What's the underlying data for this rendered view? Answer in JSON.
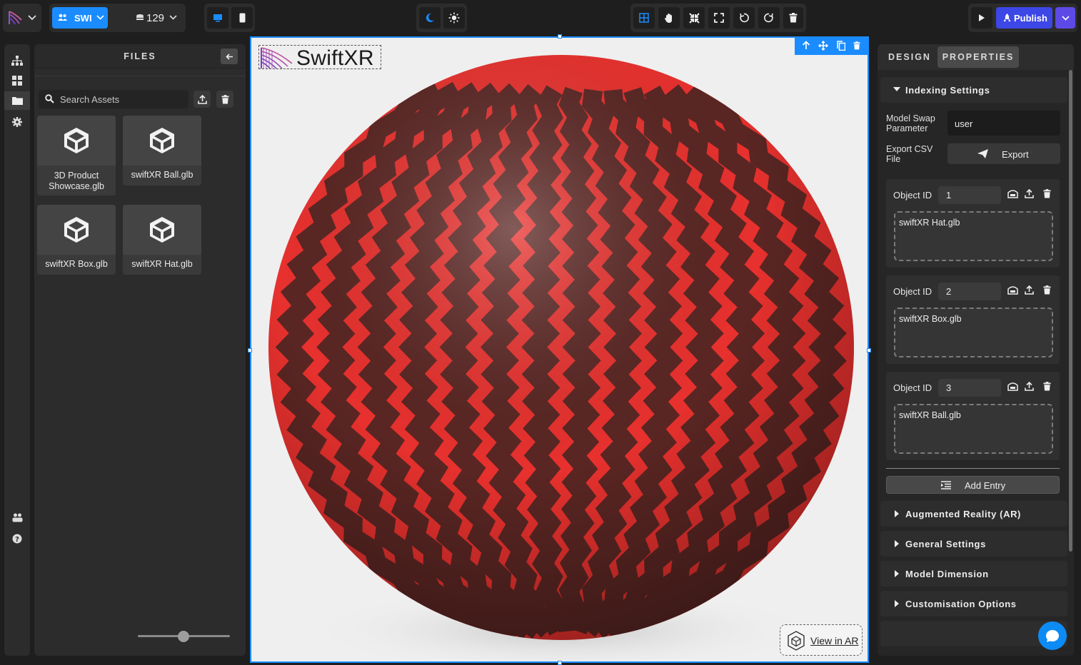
{
  "topbar": {
    "workspace_label": "SWI",
    "credits": "129",
    "publish_label": "Publish"
  },
  "files": {
    "title": "FILES",
    "search_placeholder": "Search Assets",
    "assets": [
      {
        "name": "3D Product Showcase.glb"
      },
      {
        "name": "swiftXR Ball.glb"
      },
      {
        "name": "swiftXR Box.glb"
      },
      {
        "name": "swiftXR Hat.glb"
      }
    ],
    "zoom_level": 0.5
  },
  "canvas": {
    "logo_text": "SwiftXR",
    "view_ar_label": "View in AR",
    "model_colors": {
      "primary": "#e8312e",
      "dark": "#5a2623"
    }
  },
  "right": {
    "tabs": [
      "DESIGN",
      "PROPERTIES"
    ],
    "active_tab": "PROPERTIES",
    "indexing": {
      "title": "Indexing Settings",
      "model_swap_label": "Model Swap Parameter",
      "model_swap_value": "user",
      "export_label": "Export CSV File",
      "export_button": "Export",
      "object_id_label": "Object ID",
      "entries": [
        {
          "id": "1",
          "model": "swiftXR Hat.glb"
        },
        {
          "id": "2",
          "model": "swiftXR Box.glb"
        },
        {
          "id": "3",
          "model": "swiftXR Ball.glb"
        }
      ],
      "add_entry": "Add Entry"
    },
    "sections": [
      "Augmented Reality (AR)",
      "General Settings",
      "Model Dimension",
      "Customisation Options"
    ]
  },
  "colors": {
    "accent": "#1a8cff",
    "publish": "#3d47e6"
  }
}
